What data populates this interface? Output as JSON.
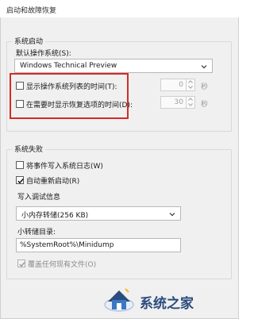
{
  "window": {
    "title": "启动和故障恢复"
  },
  "system_startup": {
    "group_label": "系统启动",
    "default_os_label": "默认操作系统(S):",
    "default_os_value": "Windows Technical Preview",
    "show_os_list_label": "显示操作系统列表的时间(T):",
    "show_os_list_checked": false,
    "show_os_list_seconds": "0",
    "show_recovery_label": "在需要时显示恢复选项的时间(D):",
    "show_recovery_checked": false,
    "show_recovery_seconds": "30",
    "seconds_unit": "秒"
  },
  "system_failure": {
    "group_label": "系统失败",
    "write_event_label": "将事件写入系统日志(W)",
    "write_event_checked": false,
    "auto_restart_label": "自动重新启动(R)",
    "auto_restart_checked": true,
    "debug_info_label": "写入调试信息",
    "debug_info_value": "小内存转储(256 KB)",
    "dump_dir_label": "小转储目录:",
    "dump_dir_value": "%SystemRoot%\\Minidump",
    "overwrite_label": "覆盖任何现有文件(O)",
    "overwrite_checked": true
  },
  "watermark": {
    "text": "系统之家"
  },
  "colors": {
    "highlight": "#d42a2a",
    "check": "#1a1a1a"
  }
}
